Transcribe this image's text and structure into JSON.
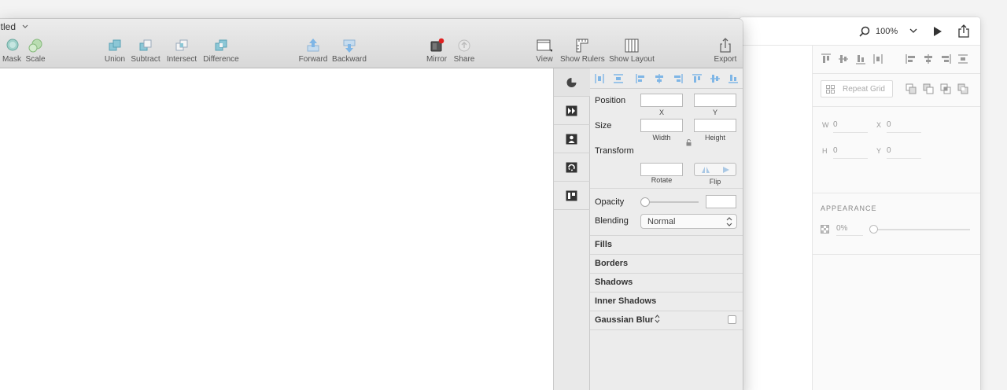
{
  "back_window": {
    "zoom_value": "100%",
    "repeat_grid_label": "Repeat Grid",
    "dimensions": {
      "w_label": "W",
      "w_value": "0",
      "x_label": "X",
      "x_value": "0",
      "h_label": "H",
      "h_value": "0",
      "y_label": "Y",
      "y_value": "0"
    },
    "appearance": {
      "title": "APPEARANCE",
      "opacity_value": "0%"
    },
    "icons": [
      "search-icon",
      "chevron-down-icon",
      "play-icon",
      "share-icon",
      "repeat-grid-icon",
      "opacity-checker-icon"
    ]
  },
  "front_window": {
    "doc_title": "itled",
    "toolbar": {
      "mask": "Mask",
      "scale": "Scale",
      "union": "Union",
      "subtract": "Subtract",
      "intersect": "Intersect",
      "difference": "Difference",
      "forward": "Forward",
      "backward": "Backward",
      "mirror": "Mirror",
      "share": "Share",
      "view": "View",
      "show_rulers": "Show Rulers",
      "show_layout": "Show Layout",
      "export": "Export"
    },
    "inspector": {
      "position_label": "Position",
      "x_label": "X",
      "y_label": "Y",
      "size_label": "Size",
      "width_label": "Width",
      "height_label": "Height",
      "transform_label": "Transform",
      "rotate_label": "Rotate",
      "flip_label": "Flip",
      "opacity_label": "Opacity",
      "blending_label": "Blending",
      "blending_value": "Normal",
      "sections": {
        "fills": "Fills",
        "borders": "Borders",
        "shadows": "Shadows",
        "inner_shadows": "Inner Shadows",
        "gaussian_blur": "Gaussian Blur"
      }
    },
    "colors": {
      "accent_blue": "#7fb6e6",
      "boolean_teal": "#8cc7d6",
      "mirror_red": "#e02020"
    }
  }
}
